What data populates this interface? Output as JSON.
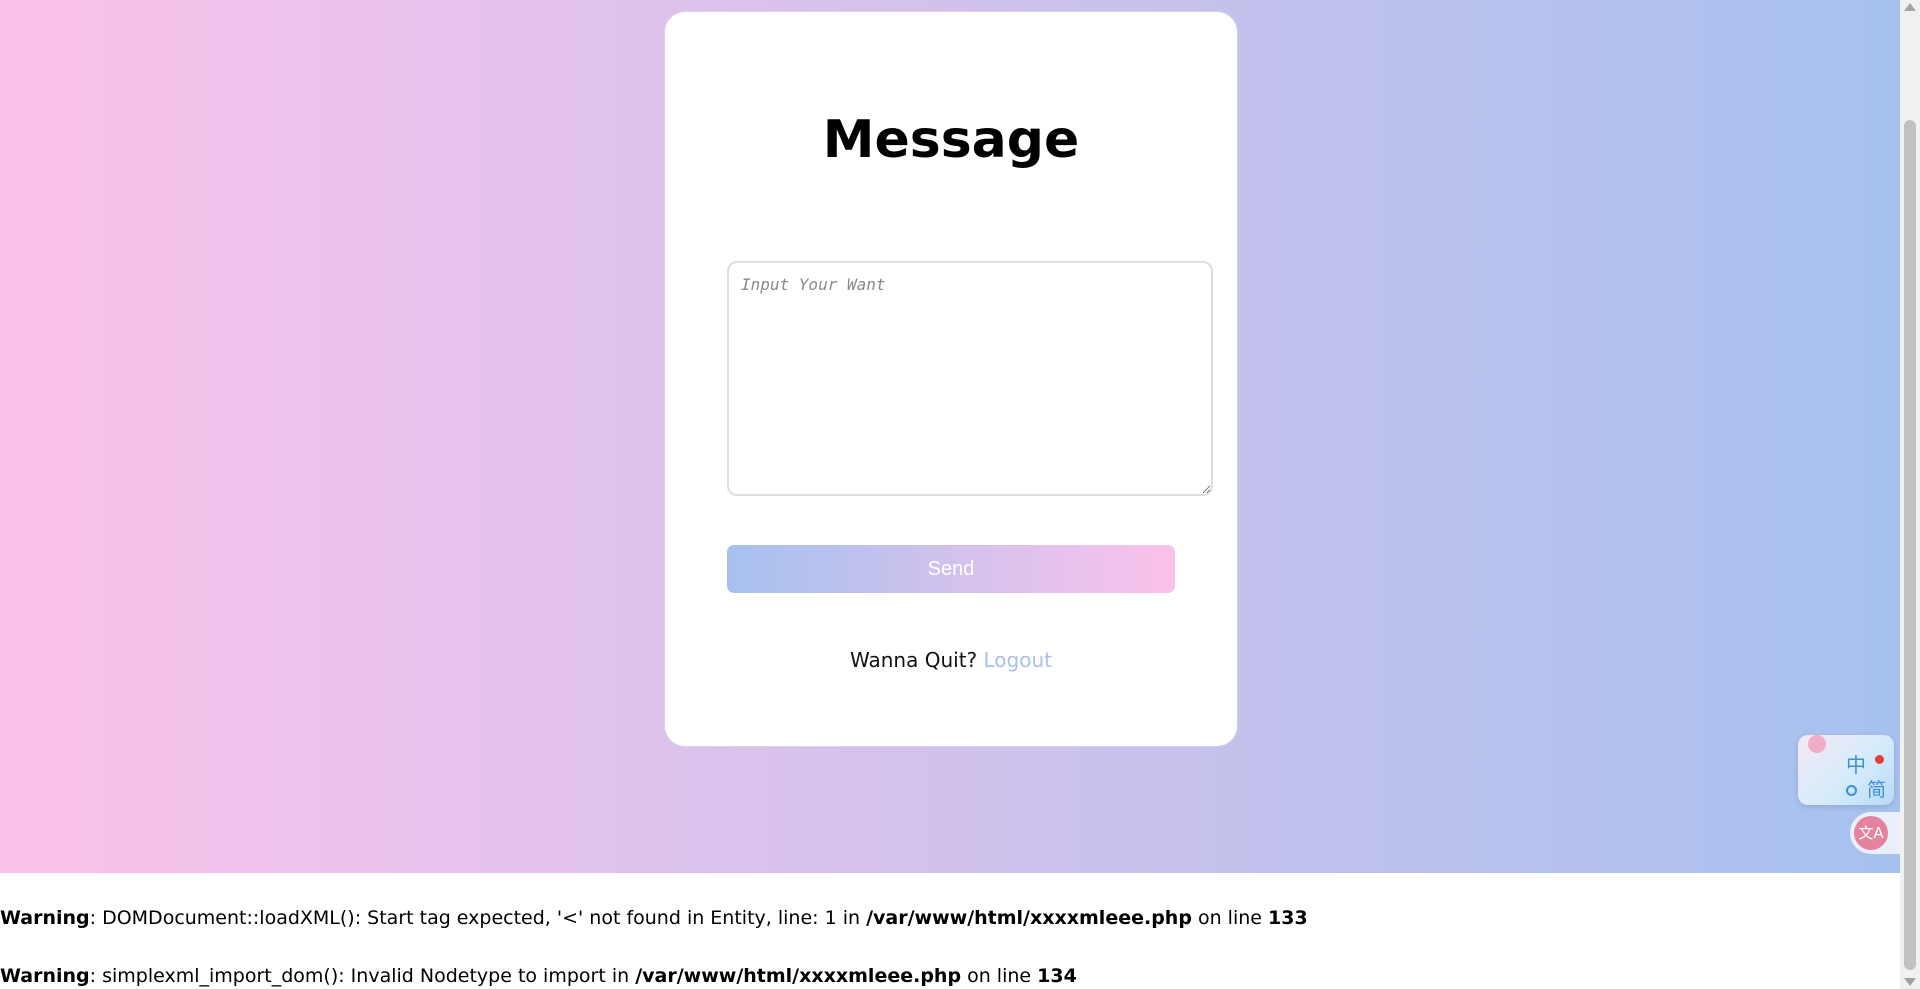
{
  "card": {
    "title": "Message",
    "textarea_placeholder": "Input Your Want",
    "textarea_value": "",
    "send_label": "Send",
    "quit_prompt": "Wanna Quit?",
    "logout_label": "Logout"
  },
  "translate_widget": {
    "char_zh": "中",
    "char_jian": "简",
    "tab_icon_text": "文A"
  },
  "warnings": [
    {
      "label": "Warning",
      "message": ": DOMDocument::loadXML(): Start tag expected, '<' not found in Entity, line: 1 in ",
      "file": "/var/www/html/xxxxmleee.php",
      "on_line": " on line ",
      "line": "133"
    },
    {
      "label": "Warning",
      "message": ": simplexml_import_dom(): Invalid Nodetype to import in ",
      "file": "/var/www/html/xxxxmleee.php",
      "on_line": " on line ",
      "line": "134"
    }
  ],
  "colors": {
    "gradient_start": "#fbc2eb",
    "gradient_end": "#a6c1ee",
    "link": "#a6c1ee"
  }
}
